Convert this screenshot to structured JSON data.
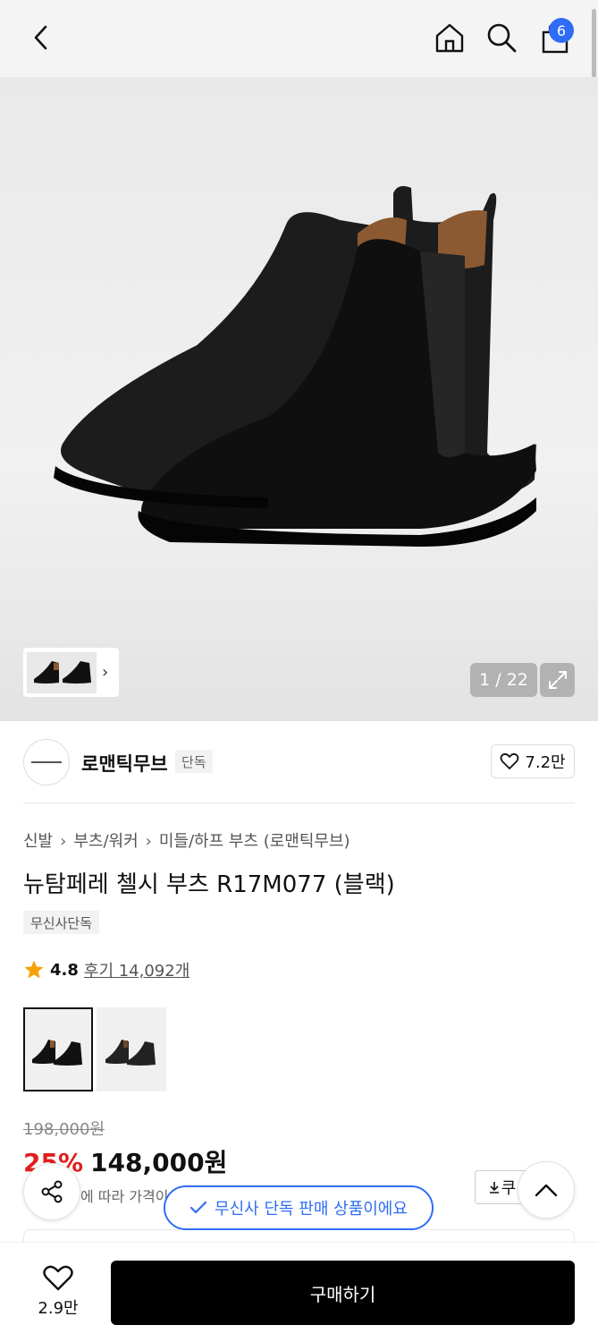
{
  "header": {
    "back_icon": "chevron-left-icon",
    "home_icon": "home-icon",
    "search_icon": "search-icon",
    "cart_icon": "shopping-bag-icon",
    "cart_count": "6"
  },
  "gallery": {
    "counter": "1 / 22",
    "expand_icon": "expand-icon",
    "thumb_chevron": "chevron-right-icon"
  },
  "brand": {
    "name": "로맨틱무브",
    "tag": "단독",
    "likes": "7.2만"
  },
  "breadcrumb": {
    "c1": "신발",
    "c2": "부츠/워커",
    "c3": "미들/하프 부츠 (로맨틱무브)"
  },
  "product": {
    "title": "뉴탐페레 첼시 부츠 R17M077 (블랙)",
    "exclusive_tag": "무신사단독",
    "rating": "4.8",
    "reviews": "후기 14,092개",
    "original_price": "198,000원",
    "discount": "25%",
    "price": "148,000원",
    "note": "에 따라 가격이"
  },
  "actions": {
    "coupon_label": "쿠",
    "toast": "무신사 단독 판매 상품이에요",
    "wish_count": "2.9만",
    "buy_label": "구매하기"
  },
  "colors": {
    "accent": "#2f6df6",
    "discount": "#e01e1e",
    "star": "#f5a20a"
  }
}
